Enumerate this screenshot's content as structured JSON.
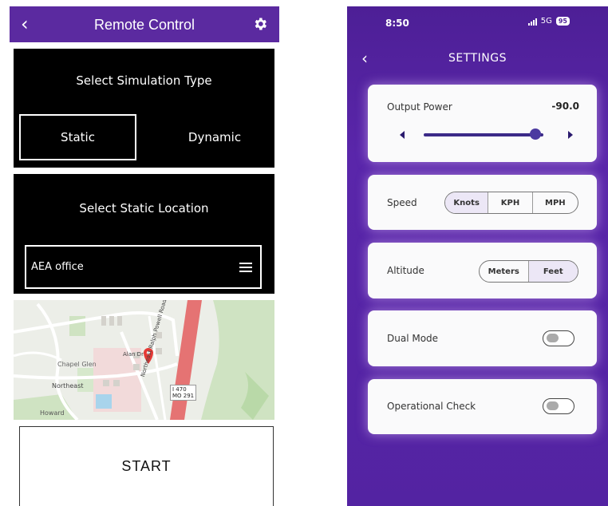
{
  "remote": {
    "title": "Remote Control",
    "sim_title": "Select Simulation Type",
    "option_static": "Static",
    "option_dynamic": "Dynamic",
    "location_title": "Select Static Location",
    "location_value": "AEA office",
    "map_labels": {
      "chapel_glen": "Chapel Glen",
      "northeast": "Northeast",
      "howard": "Howard",
      "road_label": "Northeast Ralph Powell Road",
      "highway_1": "I 470",
      "highway_2": "MO 291",
      "alan_dr": "Alan Dr"
    },
    "start_label": "START"
  },
  "settings": {
    "status_time": "8:50",
    "status_network": "5G",
    "battery": "95",
    "title": "SETTINGS",
    "output_power_label": "Output Power",
    "output_power_value": "-90.0",
    "output_power_level": 0.93,
    "speed_label": "Speed",
    "speed_options": [
      "Knots",
      "KPH",
      "MPH"
    ],
    "speed_selected": "Knots",
    "altitude_label": "Altitude",
    "altitude_options": [
      "Meters",
      "Feet"
    ],
    "altitude_selected": "Feet",
    "dual_mode_label": "Dual Mode",
    "operational_check_label": "Operational Check"
  },
  "colors": {
    "header_purple": "#5b2aa0",
    "settings_bg": "#4d1f96",
    "map_pin": "#e53935",
    "highway": "#e57373"
  }
}
